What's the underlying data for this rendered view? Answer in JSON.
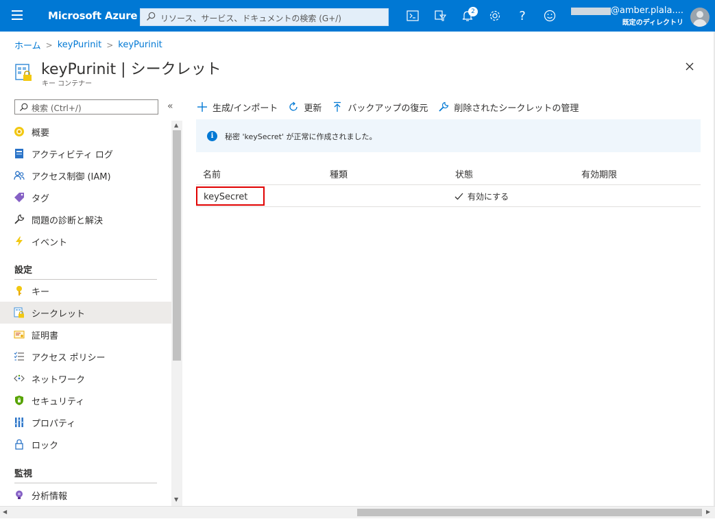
{
  "topbar": {
    "brand": "Microsoft Azure",
    "search_placeholder": "リソース、サービス、ドキュメントの検索 (G+/)",
    "notification_count": "2",
    "user_email": "@amber.plala....",
    "user_directory": "既定のディレクトリ"
  },
  "breadcrumb": [
    "ホーム",
    "keyPurinit",
    "keyPurinit"
  ],
  "header": {
    "title": "keyPurinit | シークレット",
    "subtitle": "キー コンテナー"
  },
  "sidebar": {
    "search_placeholder": "検索 (Ctrl+/)",
    "collapse_label": "«",
    "items_top": [
      {
        "label": "概要",
        "icon": "overview-icon"
      },
      {
        "label": "アクティビティ ログ",
        "icon": "activity-log-icon"
      },
      {
        "label": "アクセス制御 (IAM)",
        "icon": "iam-icon"
      },
      {
        "label": "タグ",
        "icon": "tag-icon"
      },
      {
        "label": "問題の診断と解決",
        "icon": "wrench-icon"
      },
      {
        "label": "イベント",
        "icon": "lightning-icon"
      }
    ],
    "section_settings": "設定",
    "items_settings": [
      {
        "label": "キー",
        "icon": "key-icon"
      },
      {
        "label": "シークレット",
        "icon": "secret-icon"
      },
      {
        "label": "証明書",
        "icon": "certificate-icon"
      },
      {
        "label": "アクセス ポリシー",
        "icon": "list-icon"
      },
      {
        "label": "ネットワーク",
        "icon": "network-icon"
      },
      {
        "label": "セキュリティ",
        "icon": "shield-icon"
      },
      {
        "label": "プロパティ",
        "icon": "properties-icon"
      },
      {
        "label": "ロック",
        "icon": "lock-icon"
      }
    ],
    "section_monitoring": "監視",
    "items_monitoring": [
      {
        "label": "分析情報",
        "icon": "insights-icon"
      }
    ]
  },
  "toolbar": {
    "generate": "生成/インポート",
    "refresh": "更新",
    "restore": "バックアップの復元",
    "manage_deleted": "削除されたシークレットの管理"
  },
  "banner": {
    "text": "秘密 'keySecret' が正常に作成されました。"
  },
  "table": {
    "columns": [
      "名前",
      "種類",
      "状態",
      "有効期限"
    ],
    "rows": [
      {
        "name": "keySecret",
        "type": "",
        "status": "有効にする",
        "expiry": ""
      }
    ]
  }
}
